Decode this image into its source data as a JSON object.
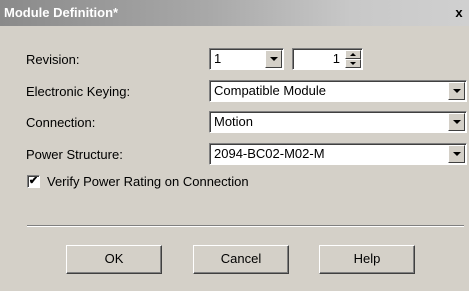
{
  "dialog": {
    "title": "Module Definition*",
    "close_glyph": "x"
  },
  "fields": {
    "revision": {
      "label": "Revision:",
      "major": "1",
      "minor": "1"
    },
    "electronic_keying": {
      "label": "Electronic Keying:",
      "value": "Compatible Module"
    },
    "connection": {
      "label": "Connection:",
      "value": "Motion"
    },
    "power_structure": {
      "label": "Power Structure:",
      "value": "2094-BC02-M02-M"
    }
  },
  "verify": {
    "label": "Verify Power Rating on Connection",
    "checked": true,
    "check_glyph": "✔"
  },
  "buttons": {
    "ok": "OK",
    "cancel": "Cancel",
    "help": "Help"
  }
}
